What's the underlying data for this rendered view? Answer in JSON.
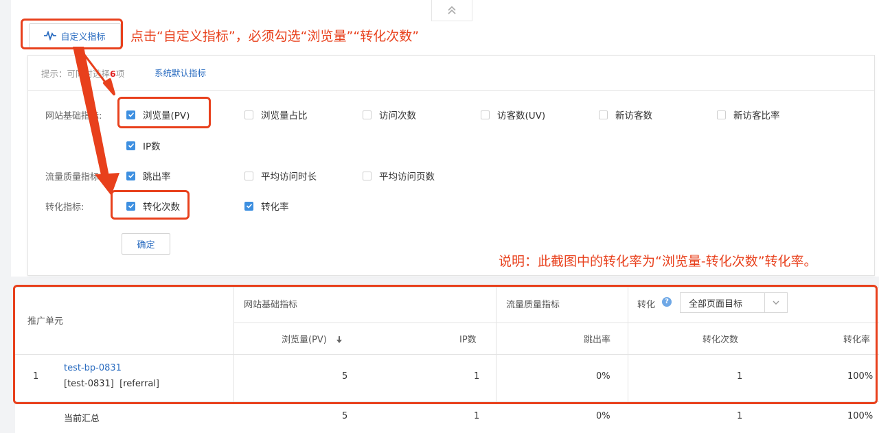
{
  "toolbar": {
    "custom_metrics_label": "自定义指标"
  },
  "annotation_top": "点击“自定义指标”，必须勾选“浏览量”“转化次数”",
  "annotation_note": "说明：此截图中的转化率为“浏览量-转化次数”转化率。",
  "panel": {
    "hint_prefix": "提示：可同时选择",
    "hint_count": "6",
    "hint_suffix": "项",
    "default_link": "系统默认指标",
    "groups": [
      {
        "label": "网站基础指标:",
        "options": [
          {
            "label": "浏览量(PV)",
            "checked": true
          },
          {
            "label": "浏览量占比",
            "checked": false
          },
          {
            "label": "访问次数",
            "checked": false
          },
          {
            "label": "访客数(UV)",
            "checked": false
          },
          {
            "label": "新访客数",
            "checked": false
          },
          {
            "label": "新访客比率",
            "checked": false
          },
          {
            "label": "IP数",
            "checked": true
          }
        ]
      },
      {
        "label": "流量质量指标:",
        "options": [
          {
            "label": "跳出率",
            "checked": true
          },
          {
            "label": "平均访问时长",
            "checked": false
          },
          {
            "label": "平均访问页数",
            "checked": false
          }
        ]
      },
      {
        "label": "转化指标:",
        "options": [
          {
            "label": "转化次数",
            "checked": true
          },
          {
            "label": "转化率",
            "checked": true
          }
        ]
      }
    ],
    "confirm_label": "确定"
  },
  "table": {
    "col_unit": "推广单元",
    "group_basic": "网站基础指标",
    "group_quality": "流量质量指标",
    "group_conversion": "转化",
    "conversion_select": "全部页面目标",
    "headers": {
      "pv": "浏览量(PV)",
      "ip": "IP数",
      "bounce": "跳出率",
      "conv_count": "转化次数",
      "conv_rate": "转化率"
    },
    "rows": [
      {
        "index": "1",
        "name": "test-bp-0831",
        "tags": "[test-0831]  [referral]",
        "pv": "5",
        "ip": "1",
        "bounce": "0%",
        "conv_count": "1",
        "conv_rate": "100%"
      }
    ],
    "total": {
      "label": "当前汇总",
      "pv": "5",
      "ip": "1",
      "bounce": "0%",
      "conv_count": "1",
      "conv_rate": "100%"
    }
  },
  "colors": {
    "accent": "#2a6cc0",
    "annotation_red": "#e8401c",
    "checkbox_blue": "#3d8fe0"
  }
}
